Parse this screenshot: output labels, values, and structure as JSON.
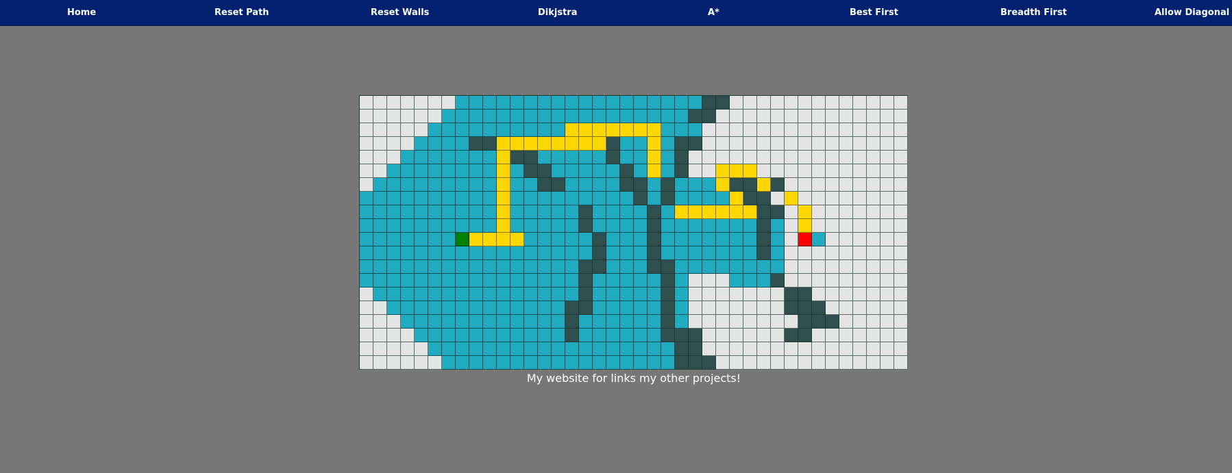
{
  "nav": {
    "home": "Home",
    "reset_path": "Reset Path",
    "reset_walls": "Reset Walls",
    "dijkstra": "Dikjstra",
    "astar": "A*",
    "best_first": "Best First",
    "breadth_first": "Breadth First",
    "allow_diagonal": "Allow Diagonal"
  },
  "colors": {
    "navbar": "#002170",
    "background": "#777777",
    "empty": "#e4e4e4",
    "visited": "#20acc0",
    "wall": "#2f4f4f",
    "path": "#ffd700",
    "start": "#008000",
    "target": "#ff0000"
  },
  "grid": {
    "legend": {
      "e": "empty",
      "v": "visited",
      "w": "wall",
      "p": "path",
      "s": "start",
      "t": "target"
    },
    "rows": [
      "eeeeeeevvvvvvvvvvvvvvvvvvwweeeeeeeeeeeee",
      "eeeeeevvvvvvvvvvvvvvvvvvwweeeeeeeeeeeeee",
      "eeeeevvvvvvvvvvpppppppvvveeeeeeeeeeeeeee",
      "eeeevvvvwwppppppppwvvpvwweeeeeeeeeeeeeee",
      "eeevvvvvvvpwwvvvvvwvvpvweeeeeeeeeeeeeeee",
      "eevvvvvvvvpvwwvvvvvwvpvweepppeeeeeeeeeee",
      "evvvvvvvvvpvvwwvvvvwwvwvvvpwwpweeeeeeeee",
      "vvvvvvvvvvpvvvvvvvvvwvwvvvvpwwepeeeeeeee",
      "vvvvvvvvvvpvvvvvwvvvvwvppppppwwepeeeeeee",
      "vvvvvvvvvvpvvvvvwvvvvwvvvvvvvwvepeeeeeee",
      "vvvvvvvsppppvvvvvwvvvwvvvvvvvwvetveeeeeee",
      "vvvvvvvvvvvvvvvvvwvvvwvvvvvvvwveeeeeeeeee",
      "vvvvvvvvvvvvvvvvwwvvvwwvvvvvvvveeeeeeeeee",
      "vvvvvvvvvvvvvvvvwvvvvvwveeevvvweeeeeeeeee",
      "evvvvvvvvvvvvvvvwvvvvvwveeeeeeewweeeeeeee",
      "eevvvvvvvvvvvvvwwvvvvvwveeeeeeewwweeeeeee",
      "eeevvvvvvvvvvvvwvvvvvvwveeeeeeeewwweeeeee",
      "eeeevvvvvvvvvvvwvvvvvvwwweeeeeewweeeeeeee",
      "eeeeevvvvvvvvvvvvvvvvvvwweeeeeeeeeeeeeeee",
      "eeeeeevvvvvvvvvvvvvvvvvwwweeeeeeeeeeeeeee"
    ]
  },
  "footer": {
    "link_text": "My website for links my other projects!"
  }
}
